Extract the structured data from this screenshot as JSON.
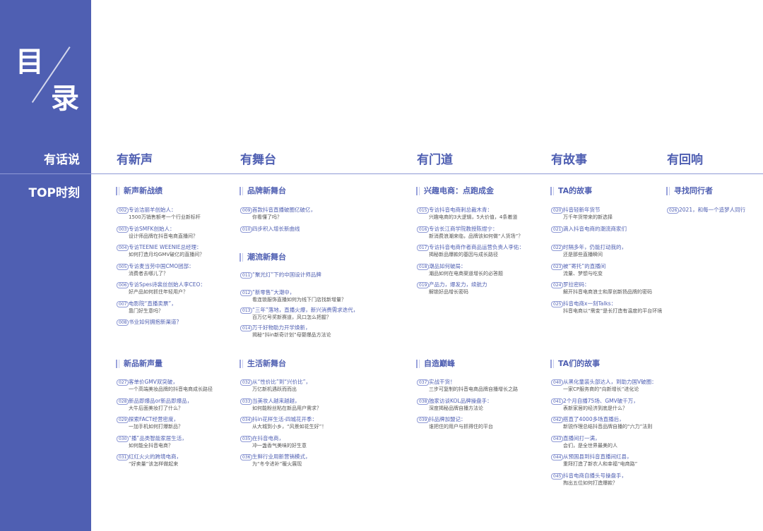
{
  "sidebar": {
    "title_1": "目",
    "title_2": "录",
    "label_1": "有话说",
    "label_2": "TOP时刻"
  },
  "columns": [
    "有新声",
    "有舞台",
    "有门道",
    "有故事",
    "有回响"
  ],
  "sections": {
    "s1": {
      "title": "新声新战绩",
      "items": [
        {
          "num": "002",
          "t1": "专访洁丽羊创始人：",
          "t2": "1500万销售额考一个行业新标杆"
        },
        {
          "num": "003",
          "t1": "专访SMFK创始人：",
          "t2": "设计师品牌在抖音电商直播间？"
        },
        {
          "num": "004",
          "t1": "专访TEENIE WEENIE总经理：",
          "t2": "如何打造月均GMV破亿的直播间？"
        },
        {
          "num": "005",
          "t1": "专访麦当劳中国CMO团部：",
          "t2": "消费者去哪儿了？"
        },
        {
          "num": "006",
          "t1": "专访Spes诗裴丝创始人李CEO：",
          "t2": "好产品如何抓住年轻用户？"
        },
        {
          "num": "007",
          "t1": "电影院“直播卖票”，",
          "t2": "靠门好生意吗？"
        },
        {
          "num": "008",
          "t1": "书业如何拥抱新渠道？",
          "t2": ""
        }
      ]
    },
    "s2": {
      "title": "品牌新舞台",
      "items": [
        {
          "num": "009",
          "t1": "首款抖音直播破圈亿破亿，",
          "t2": "你看懂了吗？"
        },
        {
          "num": "010",
          "t1": "四步积入增长新曲线",
          "t2": ""
        }
      ]
    },
    "s3": {
      "title": "潮流新舞台",
      "items": [
        {
          "num": "011",
          "t1": "“聚光灯”下的中国设计师品牌",
          "t2": ""
        },
        {
          "num": "012",
          "t1": "“新零售”大潮中，",
          "t2": "看连锁服饰直播如何为线下门店找新增量？"
        },
        {
          "num": "013",
          "t1": "“三年”落地，直播火爆，新兴消费需求迭代，",
          "t2": "百万亿号奖新赛道，风口怎么把握？"
        },
        {
          "num": "014",
          "t1": "万千好物助力开学焕新，",
          "t2": "揭秘“抖in新奇计划”母婴爆品方法论"
        }
      ]
    },
    "s4": {
      "title": "兴趣电商：点跑成金",
      "items": [
        {
          "num": "015",
          "t1": "专访抖音电商刺总裁木青：",
          "t2": "兴趣电商的3大逻辑，5大价值，4条着道"
        },
        {
          "num": "016",
          "t1": "专访长江商学院教授陈煜宁：",
          "t2": "新消费浪潮来临，品牌该如何做“人货场”？"
        },
        {
          "num": "017",
          "t1": "专访抖音电商作者商品运营负责人李佑：",
          "t2": "揭秘新品爆款的基因与成长路径"
        },
        {
          "num": "018",
          "t1": "潮品如何破局：",
          "t2": "潮品如何在电商渠道增长的必答题"
        },
        {
          "num": "019",
          "t1": "产品力，爆发力，续航力",
          "t2": "解锁好品增长密码"
        }
      ]
    },
    "s5": {
      "title": "TA的故事",
      "items": [
        {
          "num": "020",
          "t1": "抖音轻新年货节",
          "t2": "万千年货带来的新选择"
        },
        {
          "num": "021",
          "t1": "滴入抖音电商的潮流商家们",
          "t2": ""
        },
        {
          "num": "022",
          "t1": "时隔多年，仍能打动我的，",
          "t2": "还是那些直播瞬间"
        },
        {
          "num": "023",
          "t1": "被“寄托”的直播间",
          "t2": "流量、梦想与吃变"
        },
        {
          "num": "024",
          "t1": "罗拉密码：",
          "t2": "解开抖音电商浪士和厚创新扬品牌的密码"
        },
        {
          "num": "025",
          "t1": "抖音电商x一刻Talks：",
          "t2": "抖音电商以“需变”是长打造有温度的平台环境"
        }
      ]
    },
    "s6": {
      "title": "寻找同行者",
      "items": [
        {
          "num": "026",
          "t1": "2021，和每一个造梦人同行",
          "t2": ""
        }
      ]
    },
    "s7": {
      "title": "新品新声量",
      "items": [
        {
          "num": "027",
          "t1": "客单价GMV双突破，",
          "t2": "一个高端美妆品牌的抖音电商成长路径"
        },
        {
          "num": "028",
          "t1": "新品即爆品or新品即爆品，",
          "t2": "大牛后面美妆打了什么？"
        },
        {
          "num": "029",
          "t1": "探索FACT经营密度，",
          "t2": "一加手机如何打爆新品？"
        },
        {
          "num": "030",
          "t1": "“播”品类智能家居生活，",
          "t2": "如何能全抖音电商？"
        },
        {
          "num": "031",
          "t1": "红红火火的跨境电商，",
          "t2": "“好卖量”该怎样做起来"
        }
      ]
    },
    "s8": {
      "title": "生活新舞台",
      "items": [
        {
          "num": "032",
          "t1": "从“性价比”到“兴价比”，",
          "t2": "万亿新机遇跃而而出"
        },
        {
          "num": "033",
          "t1": "当美妆人越来越越，",
          "t2": "如何能粉丝粘在新品用户需求？"
        },
        {
          "num": "034",
          "t1": "抖in花样生活-四城花开季：",
          "t2": "从大城到小乡，“风景如花生好”！"
        },
        {
          "num": "035",
          "t1": "在抖音电商，",
          "t2": "冲一盏香气美味的好生意"
        },
        {
          "num": "036",
          "t1": "生鲜行业用新营销模式，",
          "t2": "为“冬令进补”暖火展现"
        }
      ]
    },
    "s9": {
      "title": "自造巅峰",
      "items": [
        {
          "num": "037",
          "t1": "实战干货！",
          "t2": "三步可复制的抖音电商品牌自播增长之路"
        },
        {
          "num": "038",
          "t1": "独家访谈KOL品牌操盘手：",
          "t2": "深度揭秘品牌自播方法论"
        },
        {
          "num": "039",
          "t1": "抖品牌加盟记：",
          "t2": "谁把住的用户与抓得住的平台"
        }
      ]
    },
    "s10": {
      "title": "TA们的故事",
      "items": [
        {
          "num": "040",
          "t1": "从黑化童装头部达人，到助力国V破圈：",
          "t2": "一家CP服务商的“向新增长”进化论"
        },
        {
          "num": "041",
          "t1": "2个月自播75场、GMV破千万，",
          "t2": "表新家居的经济到底是什么？"
        },
        {
          "num": "042",
          "t1": "搭直了4000多场直播后，",
          "t2": "新锐作理总结抖音品牌自播的“六力”法则"
        },
        {
          "num": "043",
          "t1": "直播间打一满，",
          "t2": "会们，是全世界最美的人"
        },
        {
          "num": "044",
          "t1": "从预国县到抖音直播间红县，",
          "t2": "重拜打造了新农人和幸福“电商路”"
        },
        {
          "num": "045",
          "t1": "抖音电商自播头号操盘手，",
          "t2": "掏出五位如何打造爆款？"
        }
      ]
    }
  }
}
